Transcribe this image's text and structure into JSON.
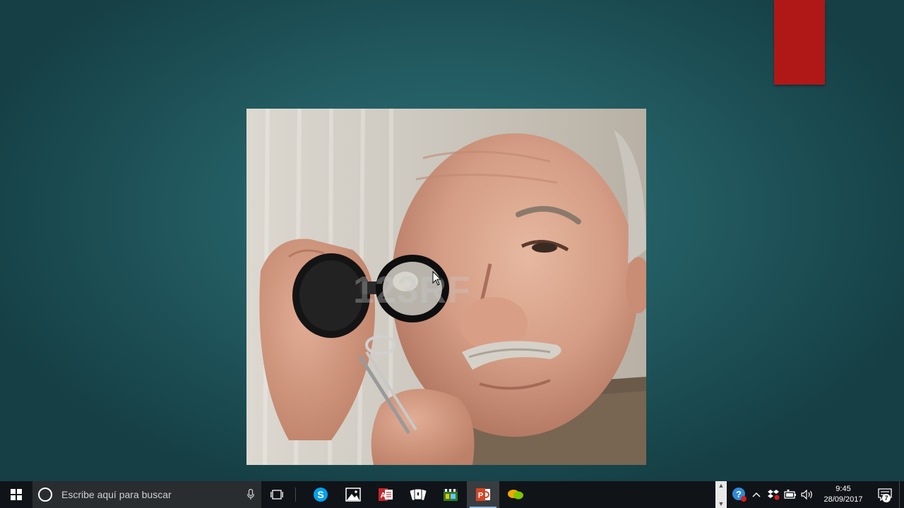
{
  "taskbar": {
    "search_placeholder": "Escribe aquí para buscar",
    "apps": [
      {
        "name": "skype",
        "icon": "skype-icon"
      },
      {
        "name": "photos",
        "icon": "photos-icon"
      },
      {
        "name": "access",
        "icon": "access-icon"
      },
      {
        "name": "solitaire",
        "icon": "cards-icon"
      },
      {
        "name": "movie-maker",
        "icon": "movie-maker-icon"
      },
      {
        "name": "powerpoint",
        "icon": "powerpoint-icon",
        "active": true
      },
      {
        "name": "chat",
        "icon": "chat-bubbles-icon"
      }
    ],
    "clock": {
      "time": "9:45",
      "date": "28/09/2017"
    },
    "notification_count": "7"
  },
  "slide": {
    "watermark": "123RF"
  },
  "colors": {
    "slide_background": "#235d63",
    "accent_red": "#b01818",
    "taskbar": "#101418"
  }
}
